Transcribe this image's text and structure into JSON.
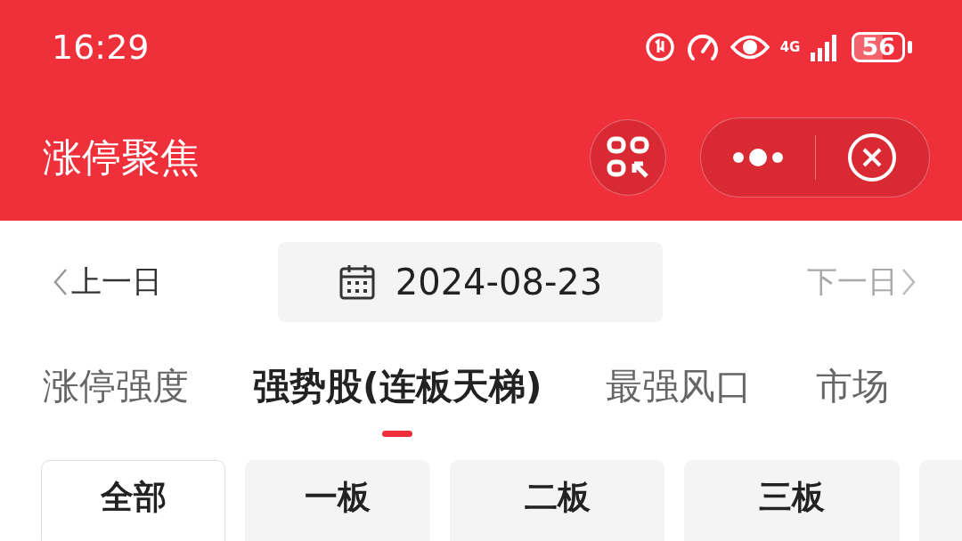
{
  "status_bar": {
    "time": "16:29",
    "network": "4G",
    "battery": "56"
  },
  "header": {
    "title": "涨停聚焦"
  },
  "date_nav": {
    "prev": {
      "label": "上一日",
      "disabled": false
    },
    "date": "2024-08-23",
    "next": {
      "label": "下一日",
      "disabled": true
    }
  },
  "tabs": [
    {
      "label": "涨停强度",
      "selected": false
    },
    {
      "label": "强势股(连板天梯)",
      "selected": true
    },
    {
      "label": "最强风口",
      "selected": false
    },
    {
      "label": "市场",
      "selected": false
    }
  ],
  "filters": [
    {
      "label": "全部",
      "selected": true
    },
    {
      "label": "一板",
      "selected": false
    },
    {
      "label": "二板",
      "selected": false
    },
    {
      "label": "三板",
      "selected": false
    }
  ]
}
